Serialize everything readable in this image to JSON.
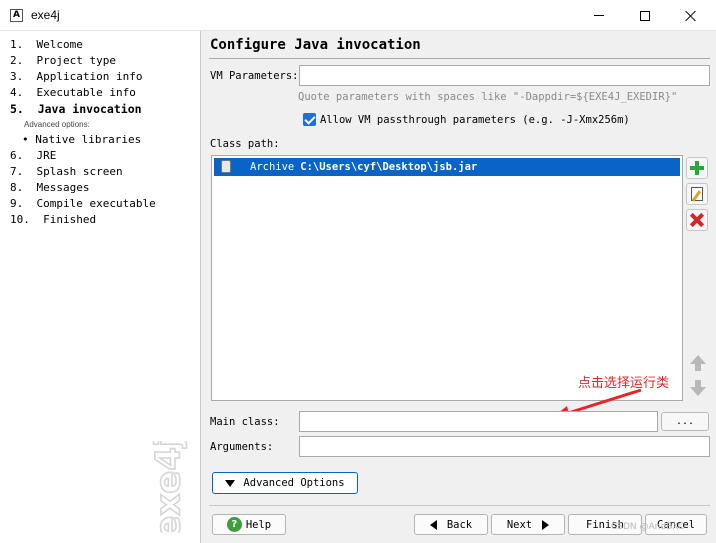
{
  "window": {
    "title": "exe4j",
    "icon_glyph": "A"
  },
  "sidebar": {
    "steps_before": [
      "1.  Welcome",
      "2.  Project type",
      "3.  Application info",
      "4.  Executable info",
      "5.  Java invocation"
    ],
    "advanced_title": "Advanced options:",
    "advanced_items": [
      "• Native libraries"
    ],
    "steps_after": [
      "6.  JRE",
      "7.  Splash screen",
      "8.  Messages",
      "9.  Compile executable",
      "10.  Finished"
    ],
    "active_index": 4,
    "watermark": "exe4j"
  },
  "main": {
    "title": "Configure Java invocation",
    "vm_parameters_label": "VM Parameters:",
    "vm_parameters_value": "",
    "vm_hint": "Quote parameters with spaces like \"-Dappdir=${EXE4J_EXEDIR}\"",
    "allow_passthrough_label": "Allow VM passthrough parameters (e.g. -J-Xmx256m)",
    "allow_passthrough_checked": true,
    "class_path_label": "Class path:",
    "class_path_entries": [
      {
        "type": "Archive",
        "path": "C:\\Users\\cyf\\Desktop\\jsb.jar"
      }
    ],
    "main_class_label": "Main class:",
    "main_class_value": "",
    "browse_label": "...",
    "arguments_label": "Arguments:",
    "arguments_value": "",
    "annotation_text": "点击选择运行类",
    "annotation_color": "#e8242a",
    "advanced_options_label": "Advanced Options"
  },
  "buttons": {
    "help": "Help",
    "back": "Back",
    "next": "Next",
    "finish": "Finish",
    "cancel": "Cancel"
  },
  "overlay_watermark": "CSDN @AndBXC",
  "colors": {
    "selection": "#0a64c8",
    "add_icon": "#2aa63a",
    "remove_icon": "#d32626"
  }
}
